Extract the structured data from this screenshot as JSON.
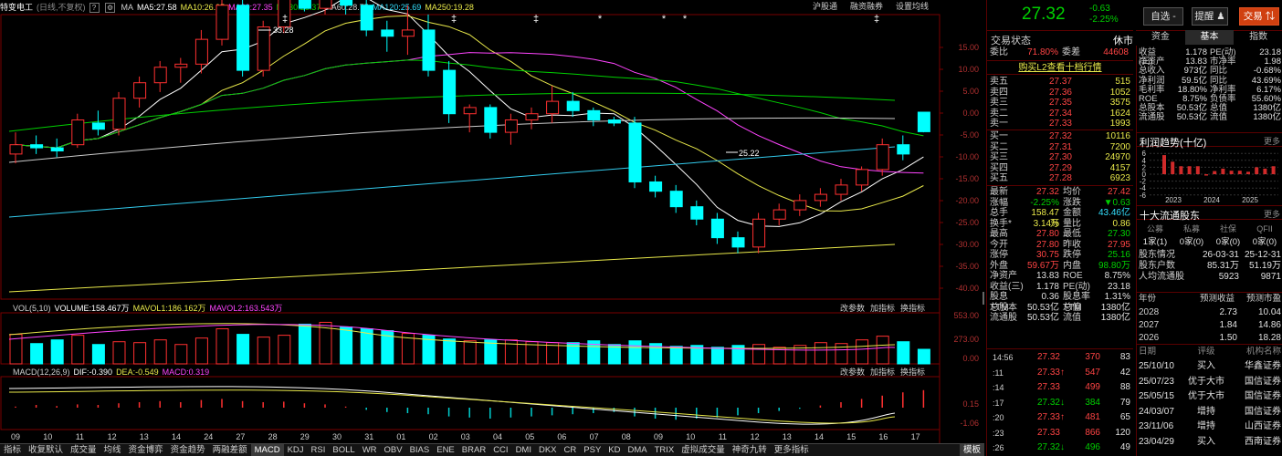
{
  "chart_header": {
    "stock": "特变电工",
    "mode": "(日线,不复权)",
    "icon1": "?",
    "icon2": "⚙",
    "ma_label": "MA",
    "ma5": "MA5:27.58",
    "ma10": "MA10:26.95",
    "ma20": "MA20:27.35",
    "ma30": "MA30:28.37",
    "ma60": "MA60:28.75",
    "ma120": "MA120:25.69",
    "ma250": "MA250:19.28",
    "link1": "沪股通",
    "link2": "融资融券",
    "link3": "设置均线"
  },
  "vol_header": {
    "title": "VOL(5,10)",
    "volume": "VOLUME:158.467万",
    "mavol1": "MAVOL1:186.162万",
    "mavol2": "MAVOL2:163.543万",
    "btn1": "改参数",
    "btn2": "加指标",
    "btn3": "换指标"
  },
  "macd_header": {
    "title": "MACD(12,26,9)",
    "dif": "DIF:-0.390",
    "dea": "DEA:-0.549",
    "macd": "MACD:0.319",
    "btn1": "改参数",
    "btn2": "加指标",
    "btn3": "换指标"
  },
  "price_axis": [
    "15.00",
    "10.00",
    "5.00",
    "0.00",
    "-5.00",
    "-10.00",
    "-15.00",
    "-20.00",
    "-25.00",
    "-30.00",
    "-35.00",
    "-40.00"
  ],
  "vol_axis": [
    "553.00",
    "273.00",
    "0.00"
  ],
  "macd_axis": [
    "0.15",
    "-1.06"
  ],
  "annotations": {
    "high": "33.28",
    "low": "25.22"
  },
  "dates": [
    "09",
    "10",
    "11",
    "12",
    "13",
    "14",
    "24",
    "27",
    "28",
    "29",
    "30",
    "31",
    "01",
    "02",
    "03",
    "04",
    "05",
    "06",
    "07",
    "08",
    "09",
    "10",
    "11",
    "12",
    "13",
    "14",
    "15",
    "16",
    "17"
  ],
  "tabs": [
    "指标",
    "收复默认",
    "成交量",
    "均线",
    "资金博弈",
    "资金趋势",
    "两融差额",
    "MACD",
    "KDJ",
    "RSI",
    "BOLL",
    "WR",
    "OBV",
    "BIAS",
    "ENE",
    "BRAR",
    "CCI",
    "DMI",
    "DKX",
    "CR",
    "PSY",
    "KD",
    "DMA",
    "TRIX",
    "虚拟成交量",
    "神奇九转",
    "更多指标",
    "模板"
  ],
  "quote": {
    "price": "27.32",
    "change": "-0.63",
    "pct": "-2.25%",
    "btn_watch": "自选 -",
    "btn_alert": "提醒 ♟",
    "btn_trade": "交易 ⇅"
  },
  "trade_status": {
    "label": "交易状态",
    "value": "休市",
    "tabs": [
      "资金",
      "基本",
      "指数"
    ]
  },
  "weibi": {
    "l1": "委比",
    "v1": "71.80%",
    "l2": "委差",
    "v2": "44608"
  },
  "l2_link": "购买L2查看十档行情",
  "sells": [
    [
      "卖五",
      "27.37",
      "515"
    ],
    [
      "卖四",
      "27.36",
      "1052"
    ],
    [
      "卖三",
      "27.35",
      "3575"
    ],
    [
      "卖二",
      "27.34",
      "1624"
    ],
    [
      "卖一",
      "27.33",
      "1993"
    ]
  ],
  "buys": [
    [
      "买一",
      "27.32",
      "10116"
    ],
    [
      "买二",
      "27.31",
      "7200"
    ],
    [
      "买三",
      "27.30",
      "24970"
    ],
    [
      "买四",
      "27.29",
      "4157"
    ],
    [
      "买五",
      "27.28",
      "6923"
    ]
  ],
  "stats": [
    [
      "最新",
      "27.32",
      "均价",
      "27.42"
    ],
    [
      "涨幅",
      "-2.25%",
      "涨跌",
      "▼0.63"
    ],
    [
      "总手",
      "158.47万",
      "金额",
      "43.46亿"
    ],
    [
      "换手*",
      "3.14%",
      "量比",
      "0.86"
    ],
    [
      "最高",
      "27.80",
      "最低",
      "27.30"
    ],
    [
      "今开",
      "27.80",
      "昨收",
      "27.95"
    ],
    [
      "涨停",
      "30.75",
      "跌停",
      "25.16"
    ],
    [
      "外盘",
      "59.67万",
      "内盘",
      "98.80万"
    ],
    [
      "净资产",
      "13.83",
      "ROE",
      "8.75%"
    ],
    [
      "收益(三)",
      "1.178",
      "PE(动)",
      "23.18"
    ],
    [
      "股息TTM",
      "0.36",
      "股息率TTM",
      "1.31%"
    ],
    [
      "总股本",
      "50.53亿",
      "总值",
      "1380亿"
    ],
    [
      "流通股",
      "50.53亿",
      "流值",
      "1380亿"
    ]
  ],
  "fundamentals": [
    [
      "收益(三)",
      "1.178",
      "PE(动)",
      "23.18"
    ],
    [
      "净资产",
      "13.83",
      "市净率",
      "1.98"
    ],
    [
      "总收入",
      "973亿",
      "同比",
      "-0.68%"
    ],
    [
      "净利润",
      "59.5亿",
      "同比",
      "43.69%"
    ],
    [
      "毛利率",
      "18.80%",
      "净利率",
      "6.17%"
    ],
    [
      "ROE",
      "8.75%",
      "负债率",
      "55.60%"
    ],
    [
      "总股本",
      "50.53亿",
      "总值",
      "1380亿"
    ],
    [
      "流通股",
      "50.53亿",
      "流值",
      "1380亿"
    ]
  ],
  "profit": {
    "title": "利润趋势(十亿)",
    "more": "更多",
    "axis": [
      "6",
      "4",
      "2",
      "0",
      "-2",
      "-4",
      "-6"
    ],
    "years": [
      "2023",
      "2024",
      "2025"
    ],
    "bars": [
      5.5,
      3.6,
      2.3,
      2.3,
      2.3,
      -0.4,
      0.9,
      1.6,
      1.0,
      1.0,
      0.7,
      2.0,
      1.6,
      2.3
    ]
  },
  "holders": {
    "title": "十大流通股东",
    "more": "更多",
    "heads": [
      "公募",
      "私募",
      "社保",
      "QFII"
    ],
    "vals": [
      "1家(1)",
      "0家(0)",
      "0家(0)",
      "0家(0)"
    ],
    "rows": [
      [
        "股东情况",
        "26-03-31",
        "25-12-31"
      ],
      [
        "股东户数",
        "85.31万",
        "51.19万"
      ],
      [
        "人均流通股",
        "5923",
        "9871"
      ]
    ]
  },
  "forecast": {
    "heads": [
      "年份",
      "预测收益",
      "预测市盈"
    ],
    "rows": [
      [
        "2028",
        "2.73",
        "10.04"
      ],
      [
        "2027",
        "1.84",
        "14.86"
      ],
      [
        "2026",
        "1.50",
        "18.28"
      ]
    ]
  },
  "ratings": {
    "heads": [
      "日期",
      "评级",
      "机构名称"
    ],
    "rows": [
      [
        "25/10/10",
        "买入",
        "华鑫证券"
      ],
      [
        "25/07/23",
        "优于大市",
        "国信证券"
      ],
      [
        "25/05/15",
        "优于大市",
        "国信证券"
      ],
      [
        "24/03/07",
        "增持",
        "国信证券"
      ],
      [
        "23/11/06",
        "增持",
        "山西证券"
      ],
      [
        "23/04/29",
        "买入",
        "西南证券"
      ]
    ]
  },
  "ticks": [
    [
      "14:56",
      "27.32",
      "370",
      "83",
      "w"
    ],
    [
      ":11",
      "27.33",
      "547",
      "42",
      "u"
    ],
    [
      ":14",
      "27.33",
      "499",
      "88",
      "n"
    ],
    [
      ":17",
      "27.32",
      "384",
      "79",
      "d"
    ],
    [
      ":20",
      "27.33",
      "481",
      "65",
      "u"
    ],
    [
      ":23",
      "27.33",
      "866",
      "120",
      "n"
    ],
    [
      ":26",
      "27.32",
      "496",
      "49",
      "d"
    ],
    [
      ":29",
      "27.33",
      "631",
      "100",
      "u"
    ]
  ],
  "chart_data": {
    "type": "candlestick",
    "ohlc": [
      [
        26.6,
        27.3,
        26.3,
        26.9
      ],
      [
        26.9,
        27.2,
        26.6,
        26.8
      ],
      [
        26.8,
        27.1,
        26.5,
        26.7
      ],
      [
        26.9,
        27.9,
        26.8,
        27.7
      ],
      [
        27.6,
        28.0,
        27.2,
        27.4
      ],
      [
        27.4,
        28.6,
        27.2,
        28.4
      ],
      [
        28.4,
        29.1,
        28.1,
        28.9
      ],
      [
        28.9,
        29.6,
        28.6,
        29.4
      ],
      [
        29.4,
        29.7,
        28.9,
        29.5
      ],
      [
        29.5,
        30.6,
        29.2,
        30.3
      ],
      [
        30.3,
        31.6,
        30.1,
        31.4
      ],
      [
        31.4,
        32.2,
        29.1,
        29.3
      ],
      [
        29.3,
        30.9,
        29.1,
        30.7
      ],
      [
        30.7,
        33.28,
        30.5,
        32.3
      ],
      [
        32.0,
        32.5,
        31.2,
        31.3
      ],
      [
        31.3,
        32.9,
        31.1,
        32.6
      ],
      [
        32.6,
        32.8,
        31.1,
        31.4
      ],
      [
        31.4,
        31.6,
        30.4,
        30.6
      ],
      [
        30.6,
        30.9,
        29.9,
        30.4
      ],
      [
        30.4,
        31.4,
        29.8,
        30.6
      ],
      [
        30.6,
        31.1,
        29.1,
        29.3
      ],
      [
        29.3,
        29.6,
        27.6,
        27.9
      ],
      [
        27.9,
        28.2,
        27.3,
        28.1
      ],
      [
        28.1,
        28.2,
        27.1,
        27.3
      ],
      [
        27.3,
        27.9,
        26.9,
        27.7
      ],
      [
        27.7,
        28.1,
        27.4,
        27.9
      ],
      [
        27.9,
        28.8,
        27.6,
        28.3
      ],
      [
        28.3,
        28.6,
        27.8,
        28.0
      ],
      [
        28.0,
        28.1,
        27.5,
        27.7
      ],
      [
        27.7,
        27.8,
        27.5,
        27.6
      ],
      [
        27.6,
        27.8,
        25.5,
        25.7
      ],
      [
        25.7,
        25.9,
        25.2,
        25.4
      ],
      [
        25.4,
        25.6,
        24.7,
        24.9
      ],
      [
        24.9,
        25.1,
        24.3,
        24.5
      ],
      [
        24.5,
        24.7,
        23.7,
        23.9
      ],
      [
        23.9,
        24.1,
        23.4,
        23.6
      ],
      [
        23.6,
        24.7,
        23.4,
        24.5
      ],
      [
        24.5,
        25.0,
        24.3,
        24.8
      ],
      [
        24.8,
        25.3,
        24.6,
        25.1
      ],
      [
        25.1,
        25.5,
        24.9,
        25.3
      ],
      [
        25.3,
        25.8,
        25.1,
        25.6
      ],
      [
        25.6,
        26.2,
        25.4,
        26.1
      ],
      [
        26.1,
        27.1,
        25.9,
        26.9
      ],
      [
        26.9,
        27.2,
        26.4,
        26.6
      ],
      [
        27.95,
        27.8,
        27.3,
        27.32
      ]
    ],
    "volumes": [
      320,
      220,
      260,
      310,
      210,
      240,
      230,
      260,
      210,
      280,
      380,
      320,
      290,
      310,
      430,
      450,
      400,
      380,
      360,
      330,
      310,
      270,
      250,
      260,
      260,
      240,
      230,
      230,
      250,
      210,
      250,
      220,
      190,
      200,
      180,
      200,
      210,
      180,
      200,
      230,
      220,
      260,
      300,
      240,
      158
    ],
    "macd_bars": [
      0.02,
      0.05,
      0.03,
      0.06,
      0.05,
      0.08,
      0.1,
      0.12,
      0.1,
      0.14,
      0.16,
      0.12,
      0.1,
      0.11,
      0.08,
      0.06,
      0.02,
      -0.04,
      -0.08,
      -0.1,
      -0.12,
      -0.16,
      -0.18,
      -0.2,
      -0.18,
      -0.16,
      -0.14,
      -0.12,
      -0.1,
      -0.08,
      -0.16,
      -0.2,
      -0.22,
      -0.2,
      -0.18,
      -0.14,
      -0.1,
      -0.06,
      -0.02,
      0.04,
      0.1,
      0.16,
      0.22,
      0.28,
      0.32
    ]
  }
}
